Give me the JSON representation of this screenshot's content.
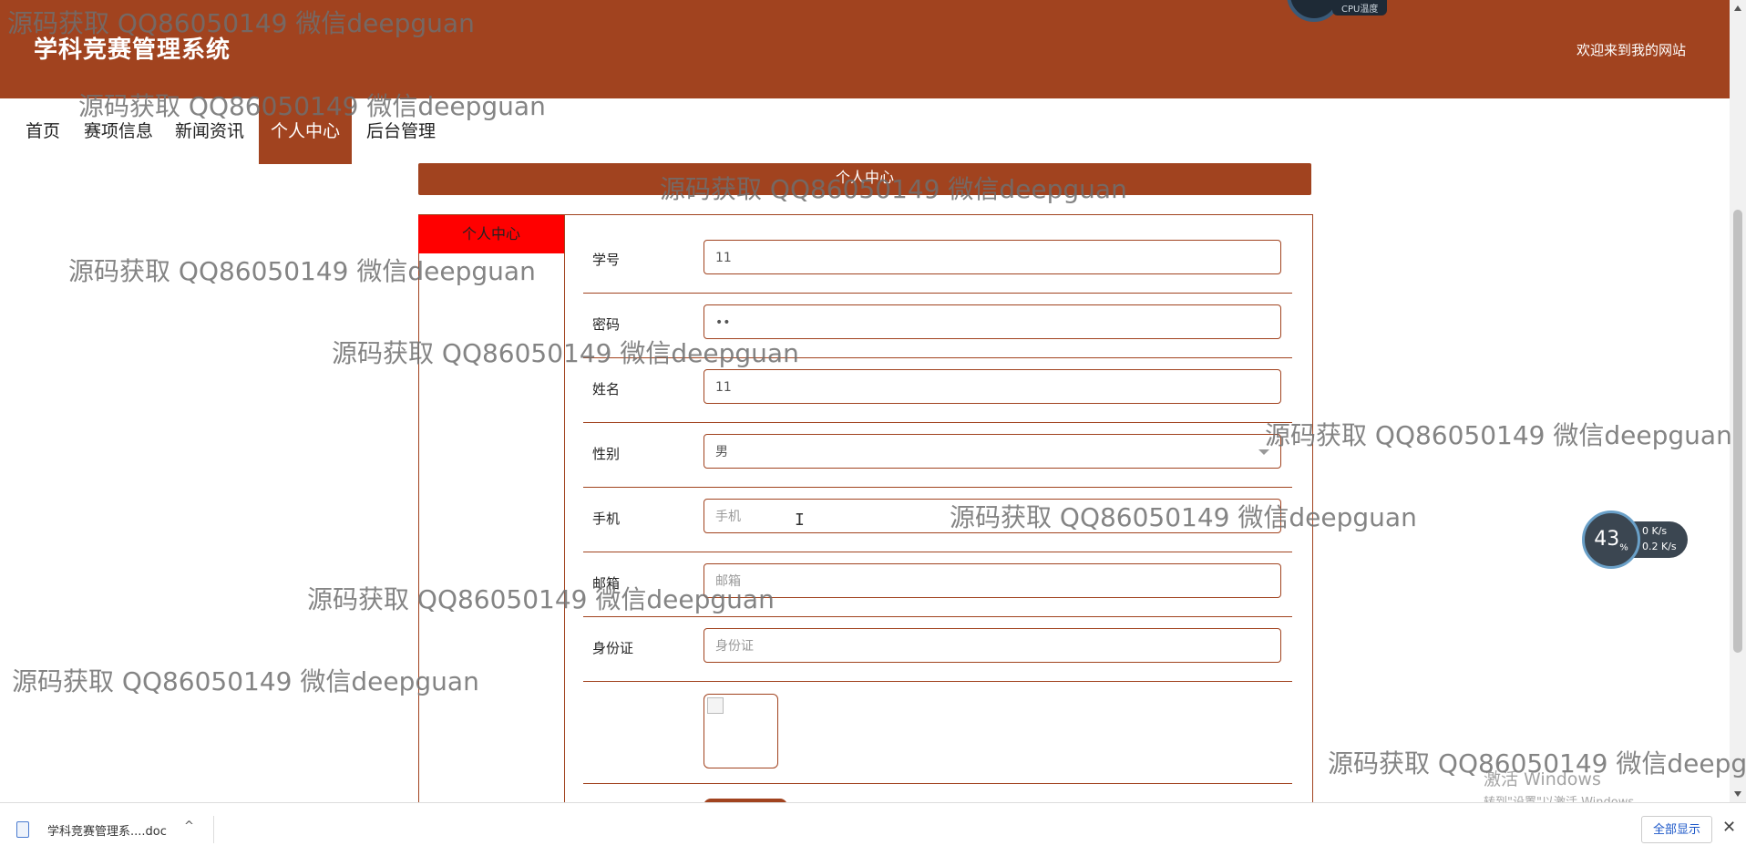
{
  "header": {
    "title": "学科竞赛管理系统",
    "welcome": "欢迎来到我的网站",
    "cpu_label": "CPU温度"
  },
  "nav": {
    "items": [
      {
        "label": "首页"
      },
      {
        "label": "赛项信息"
      },
      {
        "label": "新闻资讯"
      },
      {
        "label": "个人中心",
        "active": true
      },
      {
        "label": "后台管理"
      }
    ]
  },
  "section": {
    "title": "个人中心",
    "side_tab": "个人中心"
  },
  "form": {
    "fields": [
      {
        "label": "学号",
        "value": "11"
      },
      {
        "label": "密码",
        "value": "••"
      },
      {
        "label": "姓名",
        "value": "11"
      },
      {
        "label": "性别",
        "value": "男"
      },
      {
        "label": "手机",
        "placeholder": "手机"
      },
      {
        "label": "邮箱",
        "placeholder": "邮箱"
      },
      {
        "label": "身份证",
        "placeholder": "身份证"
      }
    ]
  },
  "net_widget": {
    "percent": "43",
    "percent_unit": "%",
    "upload": "0",
    "upload_unit": "K/s",
    "download": "0.2",
    "download_unit": "K/s"
  },
  "watermark": {
    "text": "源码获取 QQ86050149 微信deepguan"
  },
  "activation": {
    "line1": "激活 Windows",
    "line2": "转到\"设置\"以激活 Windows。"
  },
  "download_bar": {
    "file_name": "学科竞赛管理系....doc",
    "show_all": "全部显示",
    "close": "✕",
    "caret": "^"
  },
  "colors": {
    "brand": "#a1431f",
    "side_tab": "#ff0000"
  }
}
